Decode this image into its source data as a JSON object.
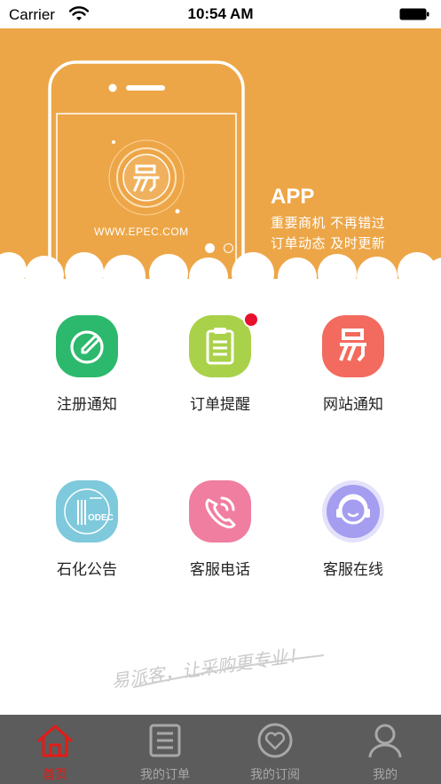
{
  "status_bar": {
    "carrier": "Carrier",
    "time": "10:54 AM"
  },
  "banner": {
    "background_color": "#eda647",
    "app_title": "APP",
    "slogan_line1": "重要商机  不再错过",
    "slogan_line2": "订单动态  及时更新",
    "phone_url": "WWW.EPEC.COM",
    "phone_logo_icon": "epec-logo-icon",
    "carousel": {
      "page_count": 2,
      "active_index": 0
    }
  },
  "grid": {
    "items": [
      {
        "label": "注册通知",
        "icon": "edit-pencil-icon",
        "color": "#2cb96d",
        "badge": false
      },
      {
        "label": "订单提醒",
        "icon": "clipboard-icon",
        "color": "#a9d149",
        "badge": true
      },
      {
        "label": "网站通知",
        "icon": "epec-logo-icon",
        "color": "#f36b5e",
        "badge": false
      },
      {
        "label": "石化公告",
        "icon": "sinopec-logo-icon",
        "color": "#7ec9dc",
        "badge": false
      },
      {
        "label": "客服电话",
        "icon": "phone-icon",
        "color": "#f07ea0",
        "badge": false
      },
      {
        "label": "客服在线",
        "icon": "headset-agent-icon",
        "color": "#a59df0",
        "badge": false
      }
    ]
  },
  "bottom_slogan": "易派客，让采购更专业！",
  "tab_bar": {
    "background_color": "#5c5c5c",
    "active_color": "#e41b17",
    "tabs": [
      {
        "label": "首页",
        "icon": "home-icon",
        "active": true
      },
      {
        "label": "我的订单",
        "icon": "order-list-icon",
        "active": false
      },
      {
        "label": "我的订阅",
        "icon": "subscription-heart-icon",
        "active": false
      },
      {
        "label": "我的",
        "icon": "user-icon",
        "active": false
      }
    ]
  }
}
